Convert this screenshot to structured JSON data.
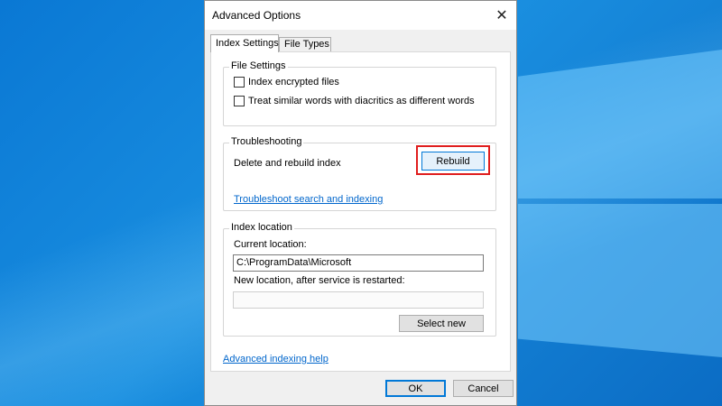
{
  "window": {
    "title": "Advanced Options",
    "close_icon": "close-icon"
  },
  "tabs": [
    {
      "label": "Index Settings",
      "selected": true
    },
    {
      "label": "File Types",
      "selected": false
    }
  ],
  "file_settings": {
    "group_label": "File Settings",
    "options": [
      {
        "label": "Index encrypted files",
        "checked": false
      },
      {
        "label": "Treat similar words with diacritics as different words",
        "checked": false
      }
    ]
  },
  "troubleshooting": {
    "group_label": "Troubleshooting",
    "rebuild_text": "Delete and rebuild index",
    "rebuild_button": "Rebuild",
    "troubleshoot_link": "Troubleshoot search and indexing",
    "highlight_color": "#e01e1e"
  },
  "index_location": {
    "group_label": "Index location",
    "current_label": "Current location:",
    "current_value": "C:\\ProgramData\\Microsoft",
    "new_label": "New location, after service is restarted:",
    "new_value": "",
    "select_new_button": "Select new"
  },
  "help_link": "Advanced indexing help",
  "footer": {
    "ok": "OK",
    "cancel": "Cancel"
  }
}
